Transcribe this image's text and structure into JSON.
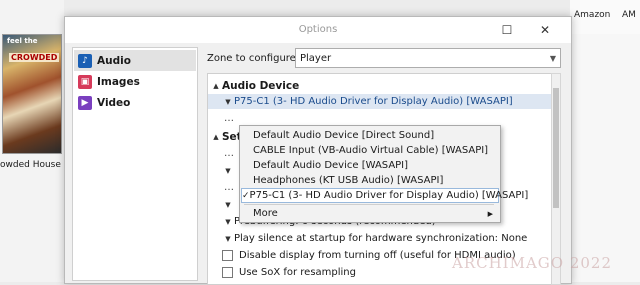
{
  "background": {
    "album_cover_text": "feel the",
    "album_cover_title": "CROWDED",
    "album_caption": "owded House (",
    "top_links": [
      "Amazon",
      "AM"
    ]
  },
  "dialog": {
    "title": "Options",
    "maximize_icon": "maximize-icon",
    "close_icon": "close-icon",
    "sidebar": [
      {
        "label": "Audio",
        "icon": "audio-note-icon",
        "color": "#1a5fb4",
        "active": true
      },
      {
        "label": "Images",
        "icon": "images-icon",
        "color": "#d63a5a",
        "active": false
      },
      {
        "label": "Video",
        "icon": "video-film-icon",
        "color": "#7a3fbf",
        "active": false
      }
    ],
    "zone": {
      "label": "Zone to configure:",
      "value": "Player"
    },
    "panel": {
      "audio_device_header": "Audio Device",
      "selected_device": "P75-C1 (3- HD Audio Driver for Display Audio) [WASAPI]",
      "dots": "…",
      "settings_header_partial": "Set",
      "rows": [
        "Prebuffering: 6 seconds (recommended)",
        "Play silence at startup for hardware synchronization: None"
      ],
      "checkboxes": [
        "Disable display from turning off (useful for HDMI audio)",
        "Use SoX for resampling"
      ]
    },
    "device_menu": {
      "items": [
        "Default Audio Device [Direct Sound]",
        "CABLE Input (VB-Audio Virtual Cable) [WASAPI]",
        "Default Audio Device [WASAPI]",
        "Headphones (KT USB Audio) [WASAPI]",
        "P75-C1 (3- HD Audio Driver for Display Audio) [WASAPI]"
      ],
      "checked_index": 4,
      "more_label": "More"
    }
  },
  "watermark": "ARCHIMAGO 2022",
  "colors": {
    "accent": "#1a5fb4",
    "selection": "#dde6f2"
  }
}
